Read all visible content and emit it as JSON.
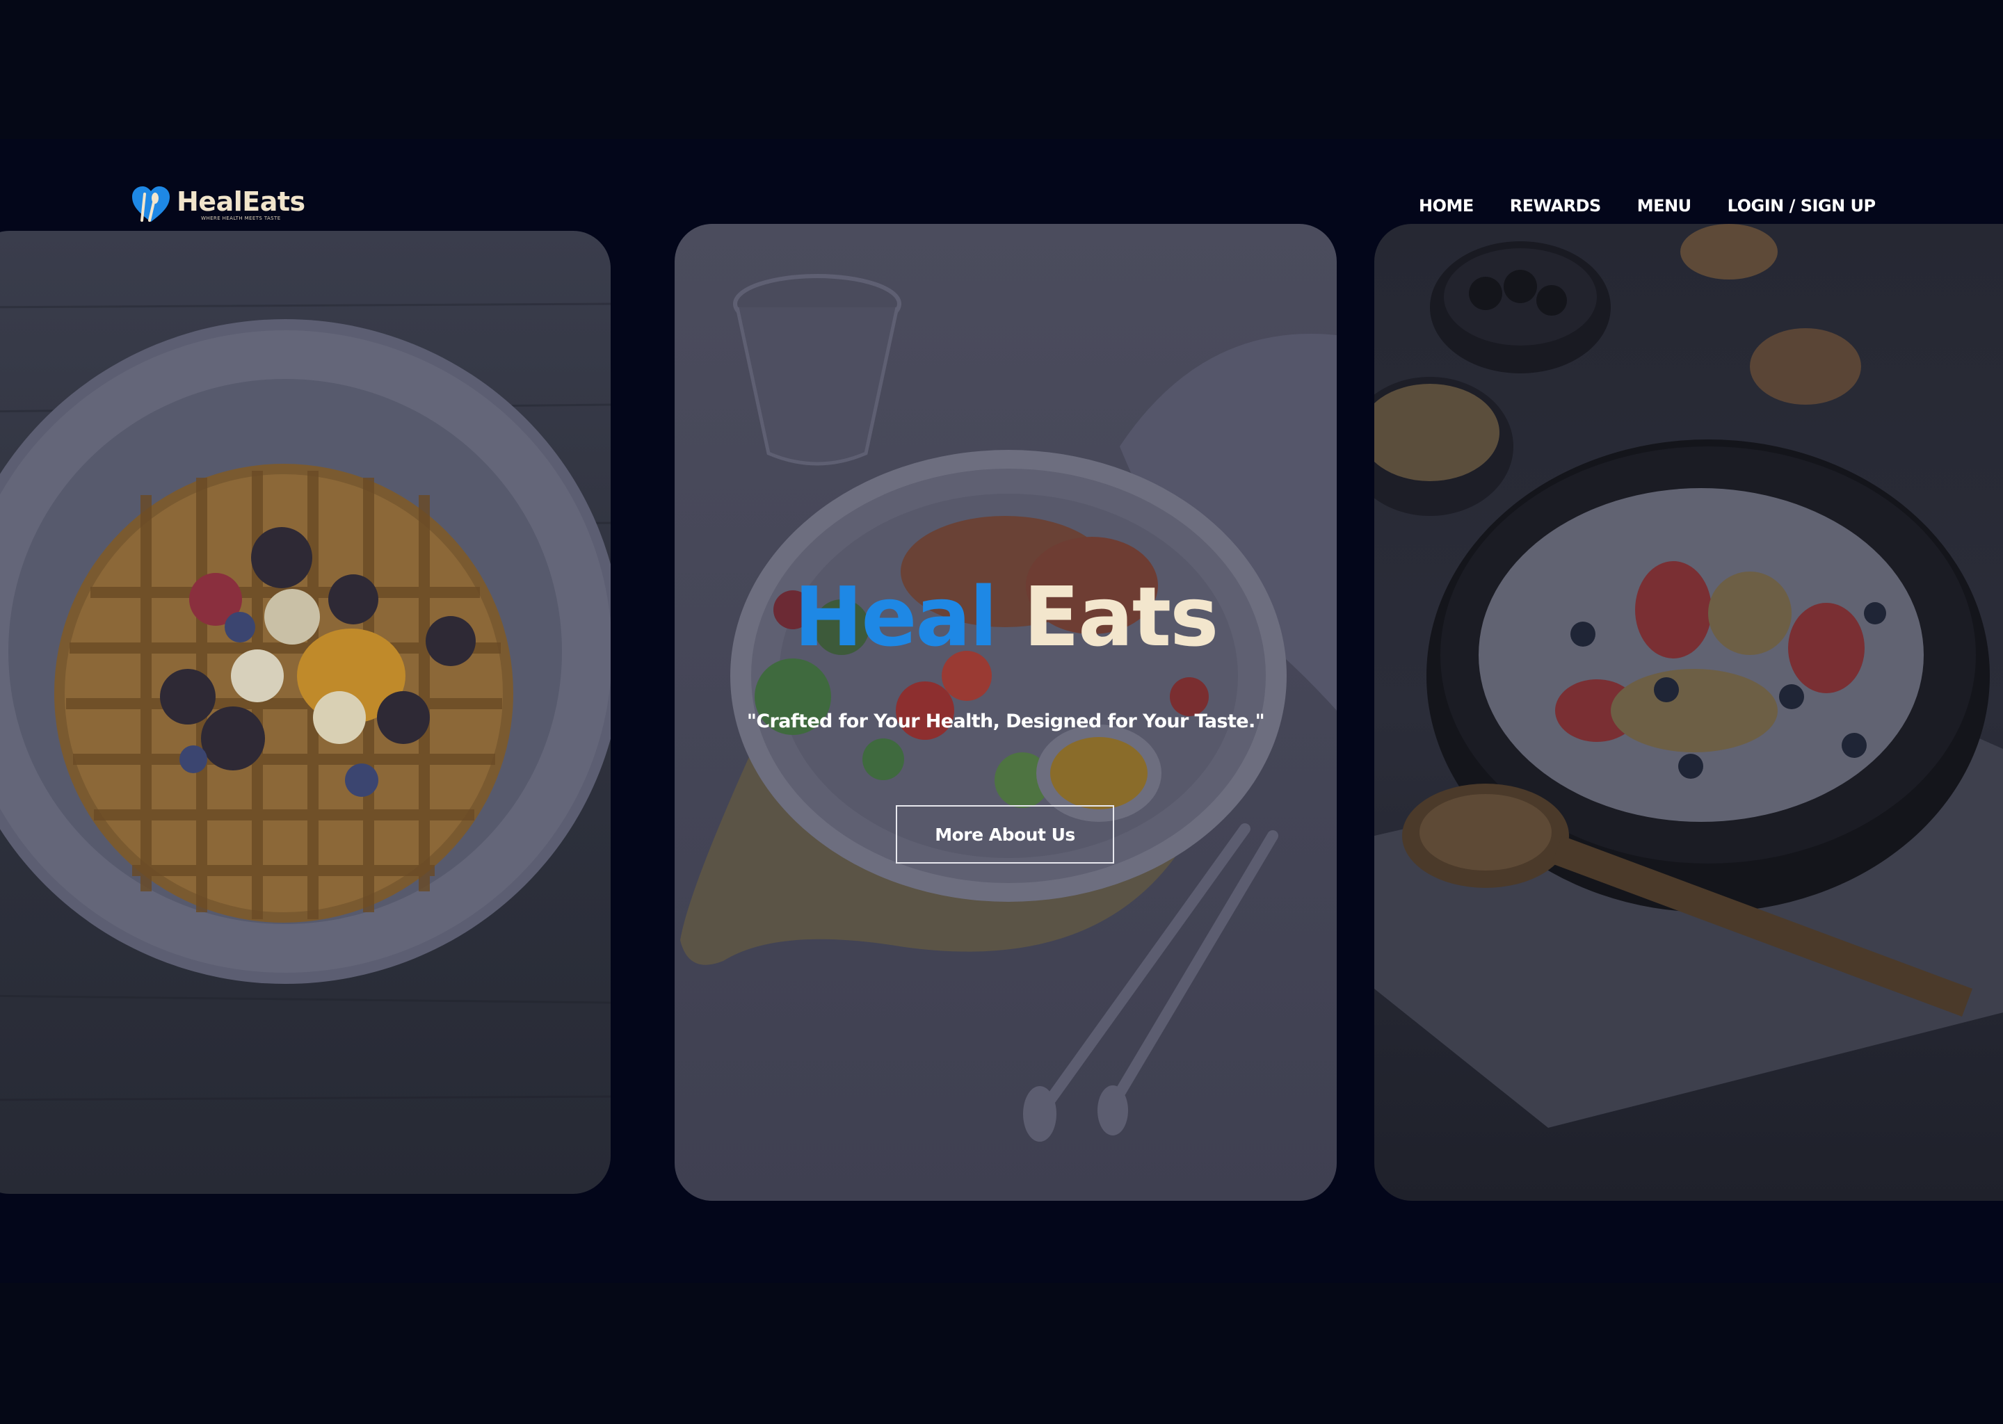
{
  "brand": {
    "name": "HealEats",
    "tagline": "WHERE HEALTH MEETS TASTE",
    "logo_icon": "heart-utensils-icon",
    "colors": {
      "primary_blue": "#1e88e5",
      "cream": "#f3e6cd",
      "background": "#050816"
    }
  },
  "nav": {
    "items": [
      {
        "label": "HOME"
      },
      {
        "label": "REWARDS"
      },
      {
        "label": "MENU"
      },
      {
        "label": "LOGIN / SIGN UP"
      }
    ]
  },
  "hero": {
    "title_part1": "Heal",
    "title_part2": "Eats",
    "subtitle": "\"Crafted for Your Health, Designed for Your Taste.\"",
    "button_label": "More About Us"
  }
}
